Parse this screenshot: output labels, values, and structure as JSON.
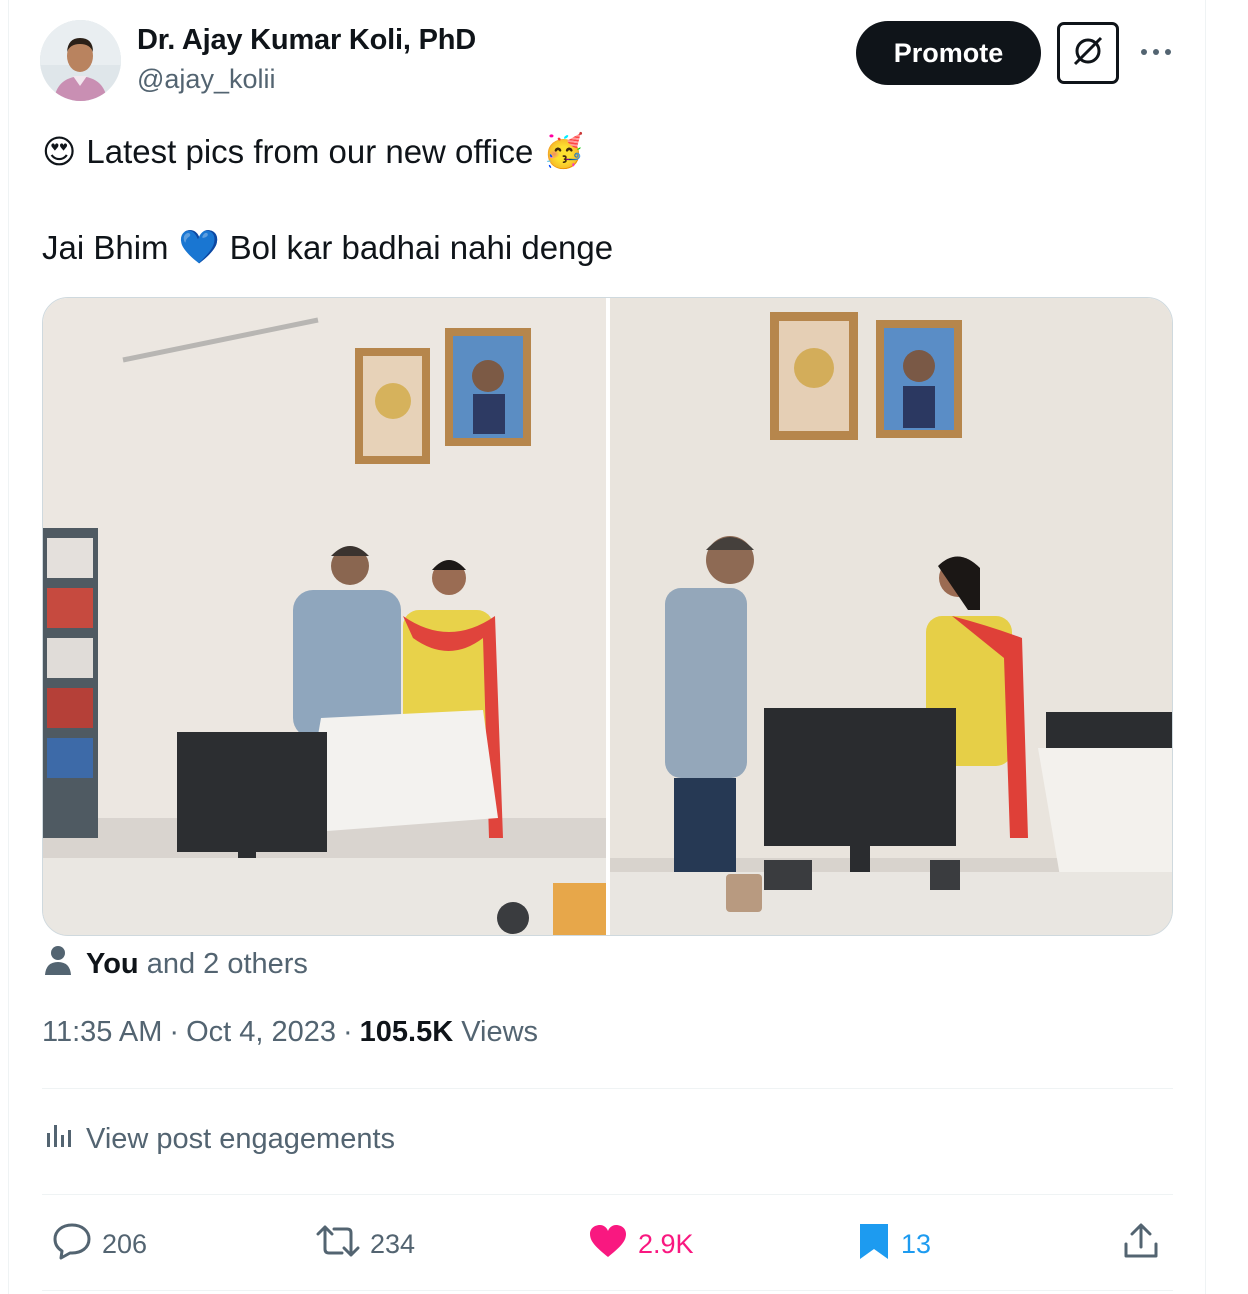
{
  "author": {
    "name": "Dr. Ajay Kumar Koli, PhD",
    "handle": "@ajay_kolii"
  },
  "header": {
    "promote_label": "Promote",
    "grok_icon": "slashed-circle-icon",
    "more_icon": "more-dots-icon"
  },
  "post": {
    "line1": {
      "lead_emoji": "😍",
      "text": "Latest pics from our new office",
      "trail_emoji": "🥳"
    },
    "line2": {
      "text_a": "Jai Bhim",
      "emoji": "💙",
      "text_b": "Bol kar badhai nahi denge"
    }
  },
  "liked_by": {
    "you": "You",
    "rest": "and 2 others"
  },
  "meta": {
    "time": "11:35 AM",
    "separator": "·",
    "date": "Oct 4, 2023",
    "views_count": "105.5K",
    "views_label": "Views"
  },
  "engagements_label": "View post engagements",
  "actions": {
    "replies": "206",
    "reposts": "234",
    "likes": "2.9K",
    "bookmarks": "13"
  },
  "colors": {
    "like": "#f91880",
    "bookmark": "#1d9bf0",
    "muted": "#536471"
  }
}
